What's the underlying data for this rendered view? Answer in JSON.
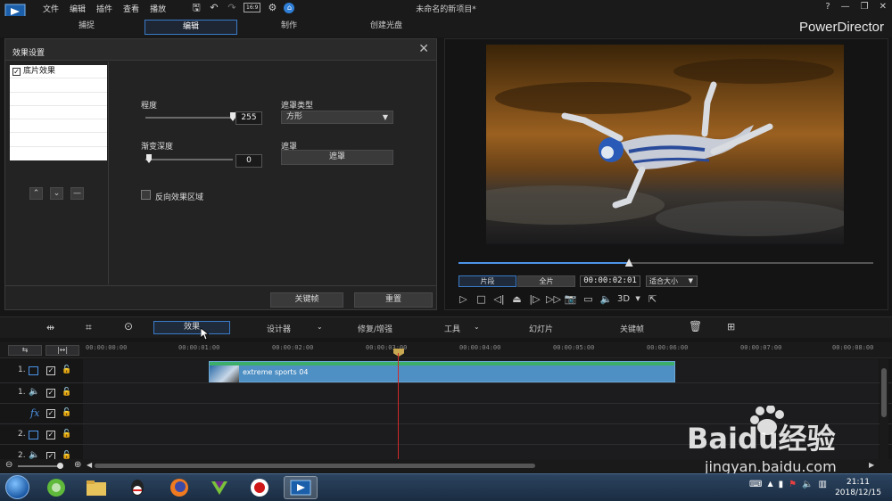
{
  "app": {
    "menu": [
      "文件",
      "编辑",
      "插件",
      "查看",
      "播放"
    ],
    "ratio": "16:9",
    "document_title": "未命名的新项目*",
    "brand": "PowerDirector",
    "window_controls": [
      "?",
      "—",
      "❐",
      "✕"
    ]
  },
  "modes": [
    {
      "label": "捕捉",
      "active": false
    },
    {
      "label": "编辑",
      "active": true
    },
    {
      "label": "制作",
      "active": false
    },
    {
      "label": "创建光盘",
      "active": false
    }
  ],
  "effect_dialog": {
    "title": "效果设置",
    "effects": [
      {
        "label": "底片效果",
        "checked": true
      }
    ],
    "degree_label": "程度",
    "degree_value": "255",
    "degree_level": 1.0,
    "fade_label": "渐变深度",
    "fade_value": "0",
    "fade_level": 0.0,
    "mask_type_label": "遮罩类型",
    "mask_type_value": "方形",
    "mask_label": "遮罩",
    "mask_button": "遮罩",
    "invert_label": "反向效果区域",
    "keyframe_button": "关键帧",
    "reset_button": "重置"
  },
  "preview": {
    "clip_button": "片段",
    "movie_button": "全片",
    "timecode": "00:00:02:01",
    "fit_label": "适合大小",
    "mode_3d": "3D",
    "progress": 0.41
  },
  "timeline_toolbar": {
    "effect": "效果",
    "designer": "设计器",
    "fix_enhance": "修复/增强",
    "tools": "工具",
    "slideshow": "幻灯片",
    "keyframe": "关键帧"
  },
  "ruler": {
    "ticks": [
      "00:00:00:00",
      "00:00:01:00",
      "00:00:02:00",
      "00:00:03:00",
      "00:00:04:00",
      "00:00:05:00",
      "00:00:06:00",
      "00:00:07:00",
      "00:00:08:00"
    ]
  },
  "tracks": [
    {
      "label": "1.",
      "kind": "video"
    },
    {
      "label": "1.",
      "kind": "audio"
    },
    {
      "label": "fx",
      "kind": "effect"
    },
    {
      "label": "2.",
      "kind": "video"
    },
    {
      "label": "2.",
      "kind": "audio"
    }
  ],
  "clip": {
    "name": "extreme sports 04"
  },
  "taskbar": {
    "time": "21:11",
    "date": "2018/12/15"
  },
  "watermark": {
    "brand": "Baidu经验",
    "url": "jingyan.baidu.com"
  },
  "colors": {
    "accent": "#3a7bc8",
    "clip": "#4e8fc4",
    "playhead": "#d02828"
  }
}
